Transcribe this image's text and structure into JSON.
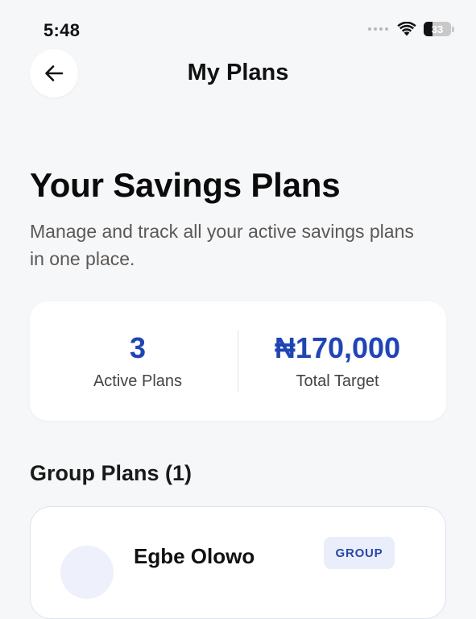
{
  "status_bar": {
    "time": "5:48",
    "battery_level": "33"
  },
  "header": {
    "title": "My Plans",
    "back_icon": "arrow-left-icon"
  },
  "hero": {
    "title": "Your Savings Plans",
    "subtitle": "Manage and track all your active savings plans in one place."
  },
  "summary": {
    "active_plans_value": "3",
    "active_plans_label": "Active Plans",
    "total_target_value": "₦170,000",
    "total_target_label": "Total Target",
    "accent_color": "#1f45b5"
  },
  "group_plans": {
    "heading": "Group Plans (1)",
    "items": [
      {
        "name": "Egbe Olowo",
        "badge": "GROUP"
      }
    ]
  }
}
